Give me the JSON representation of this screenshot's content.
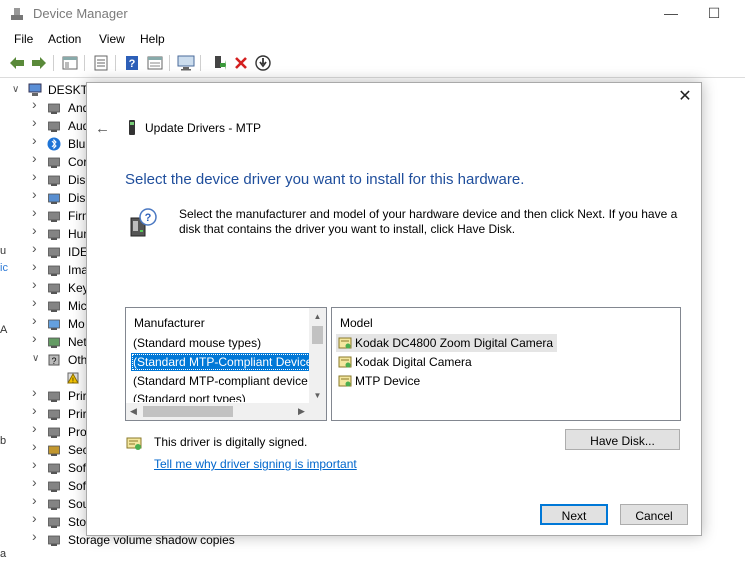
{
  "window": {
    "title": "Device Manager",
    "minimize_glyph": "—",
    "maximize_glyph": "☐"
  },
  "menu": [
    "File",
    "Action",
    "View",
    "Help"
  ],
  "tree": {
    "root": "DESKTO",
    "items": [
      {
        "label": "And",
        "icon": "audio-input-icon"
      },
      {
        "label": "Aud",
        "icon": "speaker-icon"
      },
      {
        "label": "Blu",
        "icon": "bluetooth-icon"
      },
      {
        "label": "Cor",
        "icon": "computer-icon"
      },
      {
        "label": "Disl",
        "icon": "disk-drive-icon"
      },
      {
        "label": "Disp",
        "icon": "display-adapter-icon"
      },
      {
        "label": "Firm",
        "icon": "firmware-icon"
      },
      {
        "label": "Hun",
        "icon": "hid-icon"
      },
      {
        "label": "IDE",
        "icon": "ide-controller-icon"
      },
      {
        "label": "Ima",
        "icon": "imaging-device-icon"
      },
      {
        "label": "Key",
        "icon": "keyboard-icon"
      },
      {
        "label": "Mic",
        "icon": "mouse-icon"
      },
      {
        "label": "Mo",
        "icon": "monitor-icon"
      },
      {
        "label": "Net",
        "icon": "network-adapter-icon"
      },
      {
        "label": "Oth",
        "icon": "other-devices-icon"
      },
      {
        "label": "",
        "icon": "warning-device-icon"
      },
      {
        "label": "Prir",
        "icon": "print-queue-icon"
      },
      {
        "label": "Prir",
        "icon": "printer-icon"
      },
      {
        "label": "Pro",
        "icon": "processor-icon"
      },
      {
        "label": "Sec",
        "icon": "security-device-icon"
      },
      {
        "label": "Sof",
        "icon": "software-component-icon"
      },
      {
        "label": "Sof",
        "icon": "software-device-icon"
      },
      {
        "label": "Sou",
        "icon": "sound-icon"
      },
      {
        "label": "Stor",
        "icon": "storage-controller-icon"
      },
      {
        "label": "Storage volume shadow copies",
        "icon": "storage-volume-icon"
      }
    ]
  },
  "dialog": {
    "header_title": "Update Drivers - MTP",
    "heading": "Select the device driver you want to install for this hardware.",
    "instructions": "Select the manufacturer and model of your hardware device and then click Next. If you have a disk that contains the driver you want to install, click Have Disk.",
    "manufacturer": {
      "header": "Manufacturer",
      "items": [
        "(Standard mouse types)",
        "(Standard MTP-Compliant Device",
        "(Standard MTP-compliant device",
        "(Standard port types)"
      ],
      "selected_index": 1
    },
    "model": {
      "header": "Model",
      "items": [
        "Kodak DC4800 Zoom Digital Camera",
        "Kodak Digital Camera",
        "MTP Device"
      ],
      "highlighted_index": 0
    },
    "signed_text": "This driver is digitally signed.",
    "signing_link": "Tell me why driver signing is important",
    "have_disk_label": "Have Disk...",
    "next_label": "Next",
    "cancel_label": "Cancel"
  },
  "colors": {
    "heading": "#1f4e9c",
    "selection": "#0078d7",
    "link": "#0066cc"
  }
}
